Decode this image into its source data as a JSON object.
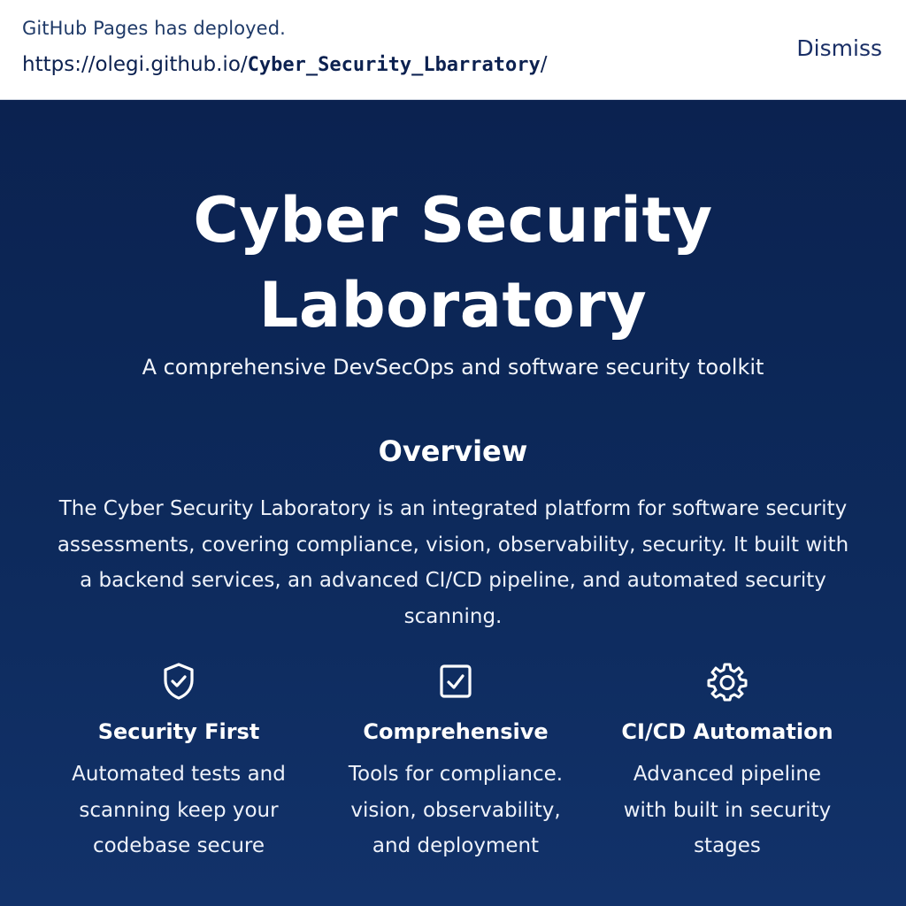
{
  "banner": {
    "message": "GitHub Pages has deployed.",
    "url_prefix": "https://olegi.github.io/",
    "url_path": "Cyber_Security_Lbarratory",
    "url_suffix": "/",
    "dismiss_label": "Dismiss"
  },
  "hero": {
    "title": "Cyber Security Laboratory",
    "subtitle": "A comprehensive DevSecOps and software security toolkit"
  },
  "overview": {
    "heading": "Overview",
    "text": "The Cyber Security Laboratory is an integrated platform for software security assessments, covering compliance, vision, observability, security. It built with a backend services, an advanced CI/CD pipeline, and automated security scanning."
  },
  "features": [
    {
      "icon": "shield-check-icon",
      "title": "Security First",
      "description": "Automated tests and scanning keep your codebase secure"
    },
    {
      "icon": "checkbox-icon",
      "title": "Comprehensive",
      "description": "Tools for compliance. vision, observability, and deployment"
    },
    {
      "icon": "gear-icon",
      "title": "CI/CD Automation",
      "description": "Advanced pipeline with built in security stages"
    }
  ],
  "colors": {
    "background": "#0b2350",
    "banner_background": "#ffffff",
    "text": "#ffffff",
    "banner_link": "#0c2150"
  }
}
